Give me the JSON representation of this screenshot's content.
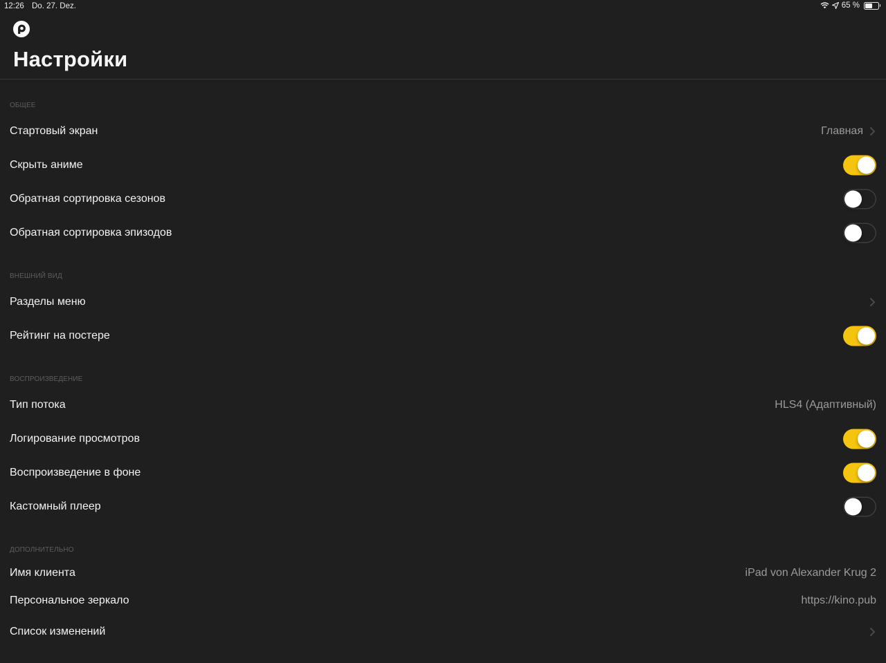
{
  "status_bar": {
    "time": "12:26",
    "date": "Do. 27. Dez.",
    "battery_text": "65 %",
    "battery_level": 0.65,
    "icons": [
      "wifi-icon",
      "location-arrow-icon",
      "battery-icon"
    ]
  },
  "header": {
    "logo_icon": "app-logo-icon",
    "title": "Настройки"
  },
  "colors": {
    "background": "#1f1f1f",
    "accent": "#f4c40f",
    "secondary_text": "#9a9a9a",
    "section_text": "#5d5d5d"
  },
  "sections": [
    {
      "title": "ОБЩЕЕ",
      "rows": [
        {
          "label": "Стартовый экран",
          "value": "Главная",
          "chevron": true
        },
        {
          "label": "Скрыть аниме",
          "toggle": true
        },
        {
          "label": "Обратная сортировка сезонов",
          "toggle": false
        },
        {
          "label": "Обратная сортировка эпизодов",
          "toggle": false
        }
      ]
    },
    {
      "title": "ВНЕШНИЙ ВИД",
      "rows": [
        {
          "label": "Разделы меню",
          "chevron": true
        },
        {
          "label": "Рейтинг на постере",
          "toggle": true
        }
      ]
    },
    {
      "title": "ВОСПРОИЗВЕДЕНИЕ",
      "rows": [
        {
          "label": "Тип потока",
          "value": "HLS4 (Адаптивный)"
        },
        {
          "label": "Логирование просмотров",
          "toggle": true
        },
        {
          "label": "Воспроизведение в фоне",
          "toggle": true
        },
        {
          "label": "Кастомный плеер",
          "toggle": false
        }
      ]
    },
    {
      "title": "ДОПОЛНИТЕЛЬНО",
      "rows": [
        {
          "label": "Имя клиента",
          "value": "iPad von Alexander Krug 2"
        },
        {
          "label": "Персональное зеркало",
          "value": "https://kino.pub"
        },
        {
          "label": "Список изменений",
          "chevron": true
        }
      ]
    }
  ]
}
